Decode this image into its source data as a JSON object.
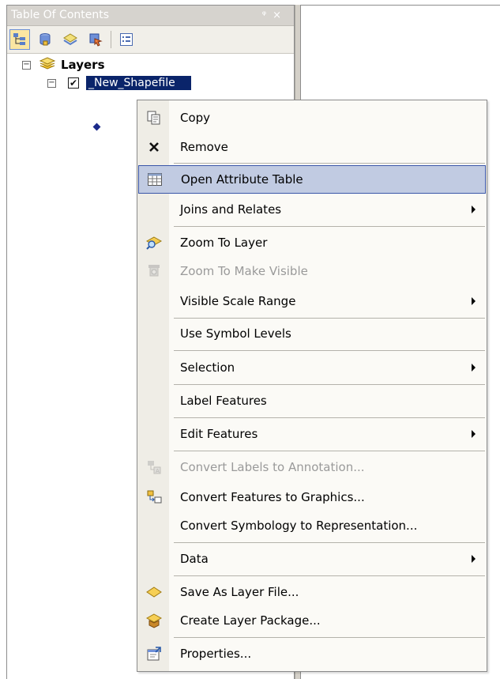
{
  "toc": {
    "title": "Table Of Contents",
    "pin_glyph": "ᵠ",
    "close_glyph": "×",
    "toolbar": [
      {
        "icon": "list-by-drawing-order-icon",
        "active": true
      },
      {
        "icon": "list-by-source-icon",
        "active": false
      },
      {
        "icon": "list-by-visibility-icon",
        "active": false
      },
      {
        "icon": "list-by-selection-icon",
        "active": false
      },
      {
        "icon": "options-icon",
        "active": false
      }
    ],
    "root_label": "Layers",
    "layer_label": "_New_Shapefile",
    "expander_glyph": "−",
    "check_glyph": "✔"
  },
  "menu": {
    "items": [
      {
        "label": "Copy",
        "icon": "copy-icon",
        "disabled": false,
        "submenu": false
      },
      {
        "label": "Remove",
        "icon": "remove-icon",
        "disabled": false,
        "submenu": false
      },
      {
        "label": "Open Attribute Table",
        "icon": "table-icon",
        "disabled": false,
        "submenu": false,
        "highlight": true
      },
      {
        "label": "Joins and Relates",
        "icon": "",
        "disabled": false,
        "submenu": true
      },
      {
        "label": "Zoom To Layer",
        "icon": "zoom-to-layer-icon",
        "disabled": false,
        "submenu": false
      },
      {
        "label": "Zoom To Make Visible",
        "icon": "zoom-visible-icon",
        "disabled": true,
        "submenu": false
      },
      {
        "label": "Visible Scale Range",
        "icon": "",
        "disabled": false,
        "submenu": true
      },
      {
        "label": "Use Symbol Levels",
        "icon": "",
        "disabled": false,
        "submenu": false
      },
      {
        "label": "Selection",
        "icon": "",
        "disabled": false,
        "submenu": true
      },
      {
        "label": "Label Features",
        "icon": "",
        "disabled": false,
        "submenu": false
      },
      {
        "label": "Edit Features",
        "icon": "",
        "disabled": false,
        "submenu": true
      },
      {
        "label": "Convert Labels to Annotation...",
        "icon": "convert-labels-icon",
        "disabled": true,
        "submenu": false
      },
      {
        "label": "Convert Features to Graphics...",
        "icon": "convert-graphics-icon",
        "disabled": false,
        "submenu": false
      },
      {
        "label": "Convert Symbology to Representation...",
        "icon": "",
        "disabled": false,
        "submenu": false
      },
      {
        "label": "Data",
        "icon": "",
        "disabled": false,
        "submenu": true
      },
      {
        "label": "Save As Layer File...",
        "icon": "layer-file-icon",
        "disabled": false,
        "submenu": false
      },
      {
        "label": "Create Layer Package...",
        "icon": "layer-package-icon",
        "disabled": false,
        "submenu": false
      },
      {
        "label": "Properties...",
        "icon": "properties-icon",
        "disabled": false,
        "submenu": false
      }
    ]
  }
}
